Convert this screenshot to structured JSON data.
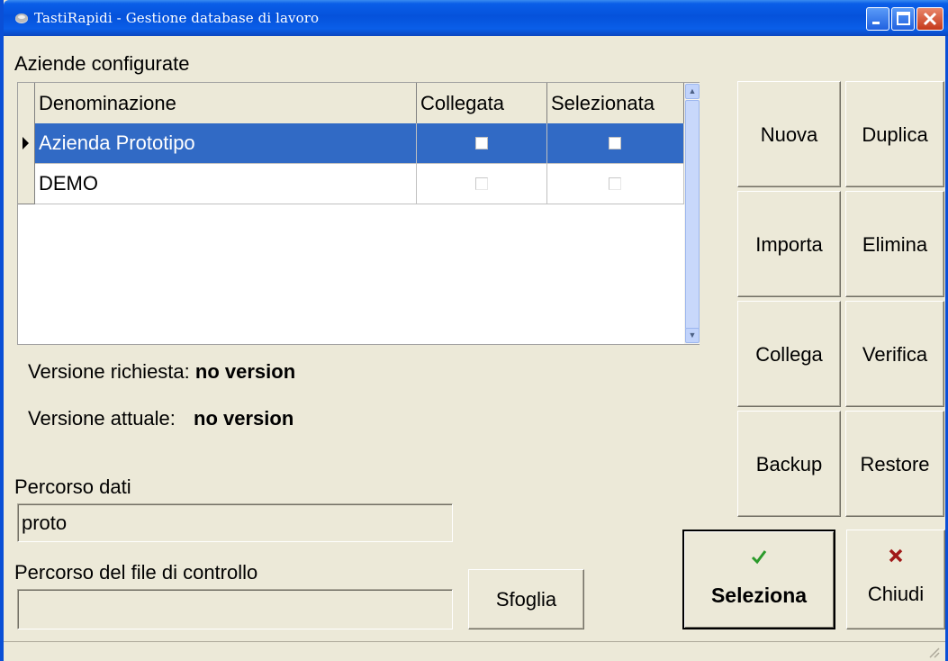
{
  "window": {
    "title": "TastiRapidi - Gestione database di lavoro",
    "accent": "#0a5ee8"
  },
  "section_label": "Aziende configurate",
  "table": {
    "columns": [
      "Denominazione",
      "Collegata",
      "Selezionata"
    ],
    "rows": [
      {
        "name": "Azienda Prototipo",
        "collegata": false,
        "selezionata": false,
        "selected": true
      },
      {
        "name": "DEMO",
        "collegata": false,
        "selezionata": false,
        "selected": false
      }
    ],
    "selection_color": "#316ac5"
  },
  "version": {
    "required_label": "Versione richiesta:",
    "required_value": "no version",
    "current_label": "Versione attuale:",
    "current_value": "no version"
  },
  "data_path": {
    "label": "Percorso dati",
    "value": "proto"
  },
  "control_file": {
    "label": "Percorso del file di controllo",
    "value": ""
  },
  "buttons": {
    "nuova": "Nuova",
    "duplica": "Duplica",
    "importa": "Importa",
    "elimina": "Elimina",
    "collega": "Collega",
    "verifica": "Verifica",
    "backup": "Backup",
    "restore": "Restore",
    "sfoglia": "Sfoglia",
    "seleziona": "Seleziona",
    "chiudi": "Chiudi"
  },
  "icons": {
    "seleziona": "checkmark-icon",
    "chiudi": "x-icon",
    "check_color": "#2a9a2a",
    "close_color": "#a01818"
  }
}
